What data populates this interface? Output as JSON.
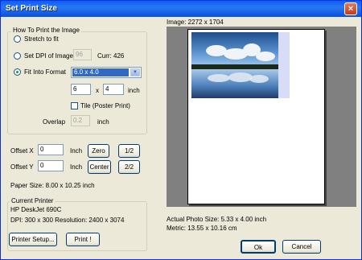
{
  "window": {
    "title": "Set Print Size",
    "close": "×"
  },
  "how": {
    "legend": "How To Print the Image",
    "stretch_label": "Stretch to fit",
    "dpi_label": "Set DPI of Image",
    "dpi_value": "96",
    "curr_label": "Curr: 426",
    "fit_label": "Fit Into Format",
    "format_value": "6.0 x 4.0",
    "width_value": "6",
    "x_label": "x",
    "height_value": "4",
    "inch_label": "inch",
    "tile_label": "Tile (Poster Print)",
    "overlap_label": "Overlap",
    "overlap_value": "0.2",
    "overlap_unit": "inch"
  },
  "offset": {
    "x_label": "Offset X",
    "x_value": "0",
    "x_unit": "Inch",
    "y_label": "Offset Y",
    "y_value": "0",
    "y_unit": "Inch",
    "zero": "Zero",
    "half": "1/2",
    "center": "Center",
    "twohalf": "2/2"
  },
  "paper_size": "Paper Size: 8.00 x 10.25 inch",
  "printer": {
    "legend": "Current Printer",
    "name": "HP DeskJet 690C",
    "dpi": "DPI: 300 x 300  Resolution: 2400 x 3074",
    "setup": "Printer Setup...",
    "print": "Print !"
  },
  "image_info": "Image: 2272 x 1704",
  "actual_size": "Actual Photo Size: 5.33 x 4.00 inch",
  "metric": "Metric: 13.55 x 10.16 cm",
  "buttons": {
    "ok": "Ok",
    "cancel": "Cancel"
  }
}
